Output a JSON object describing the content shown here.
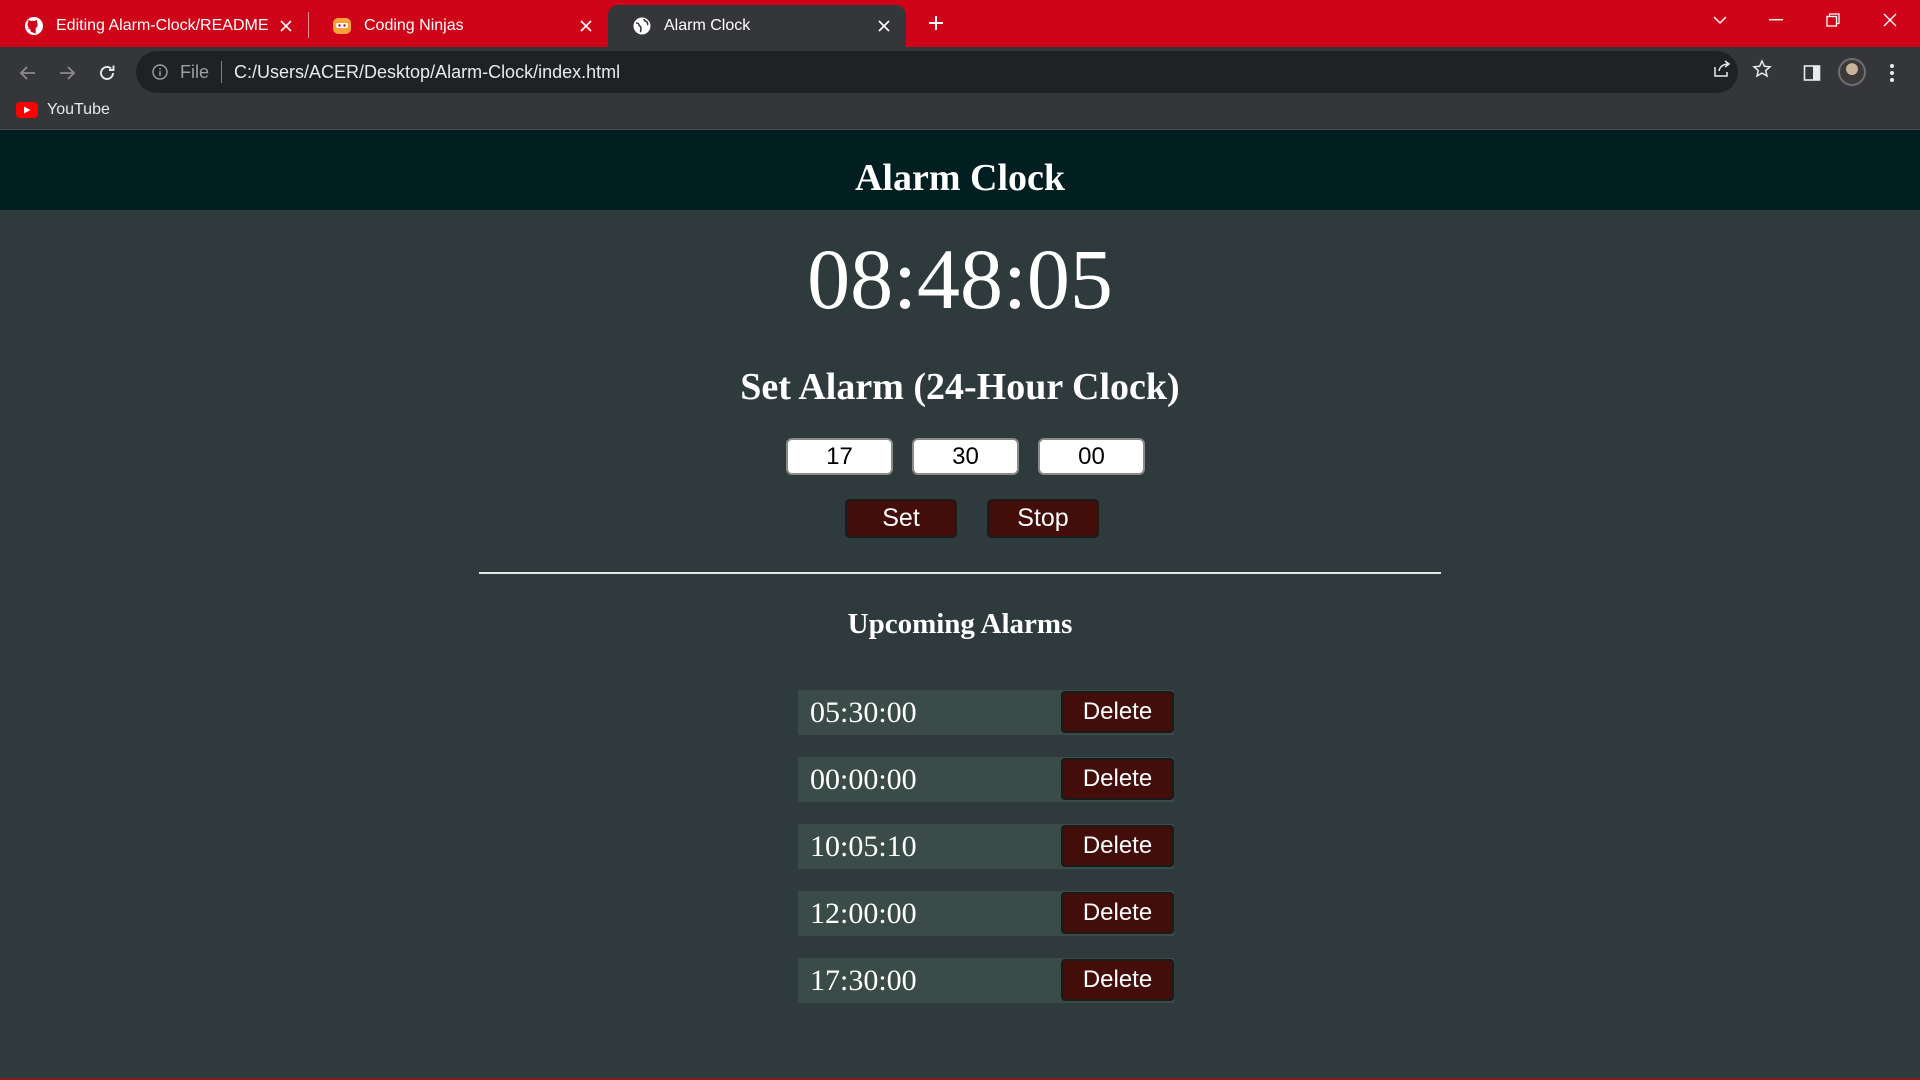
{
  "browser": {
    "tabs": [
      {
        "title": "Editing Alarm-Clock/README.md",
        "icon": "github-icon"
      },
      {
        "title": "Coding Ninjas",
        "icon": "coding-ninjas-icon"
      },
      {
        "title": "Alarm Clock",
        "icon": "globe-icon"
      }
    ],
    "active_tab": 2,
    "address": {
      "scheme_label": "File",
      "url": "C:/Users/ACER/Desktop/Alarm-Clock/index.html"
    },
    "bookmarks": [
      {
        "label": "YouTube",
        "icon": "youtube-icon"
      }
    ],
    "colors": {
      "tabstrip": "#d00418",
      "toolbar": "#35363a",
      "omnibox": "#202124"
    }
  },
  "app": {
    "title": "Alarm Clock",
    "current_time": "08:48:05",
    "set_heading": "Set Alarm (24-Hour Clock)",
    "inputs": {
      "hours": "17",
      "minutes": "30",
      "seconds": "00"
    },
    "buttons": {
      "set": "Set",
      "stop": "Stop"
    },
    "upcoming_heading": "Upcoming Alarms",
    "alarms": [
      {
        "time": "05:30:00",
        "delete_label": "Delete"
      },
      {
        "time": "00:00:00",
        "delete_label": "Delete"
      },
      {
        "time": "10:05:10",
        "delete_label": "Delete"
      },
      {
        "time": "12:00:00",
        "delete_label": "Delete"
      },
      {
        "time": "17:30:00",
        "delete_label": "Delete"
      }
    ],
    "colors": {
      "header": "#011f20",
      "background": "#2e3a3b",
      "button": "#430d0a",
      "alarm_row": "#3a4b48"
    }
  }
}
